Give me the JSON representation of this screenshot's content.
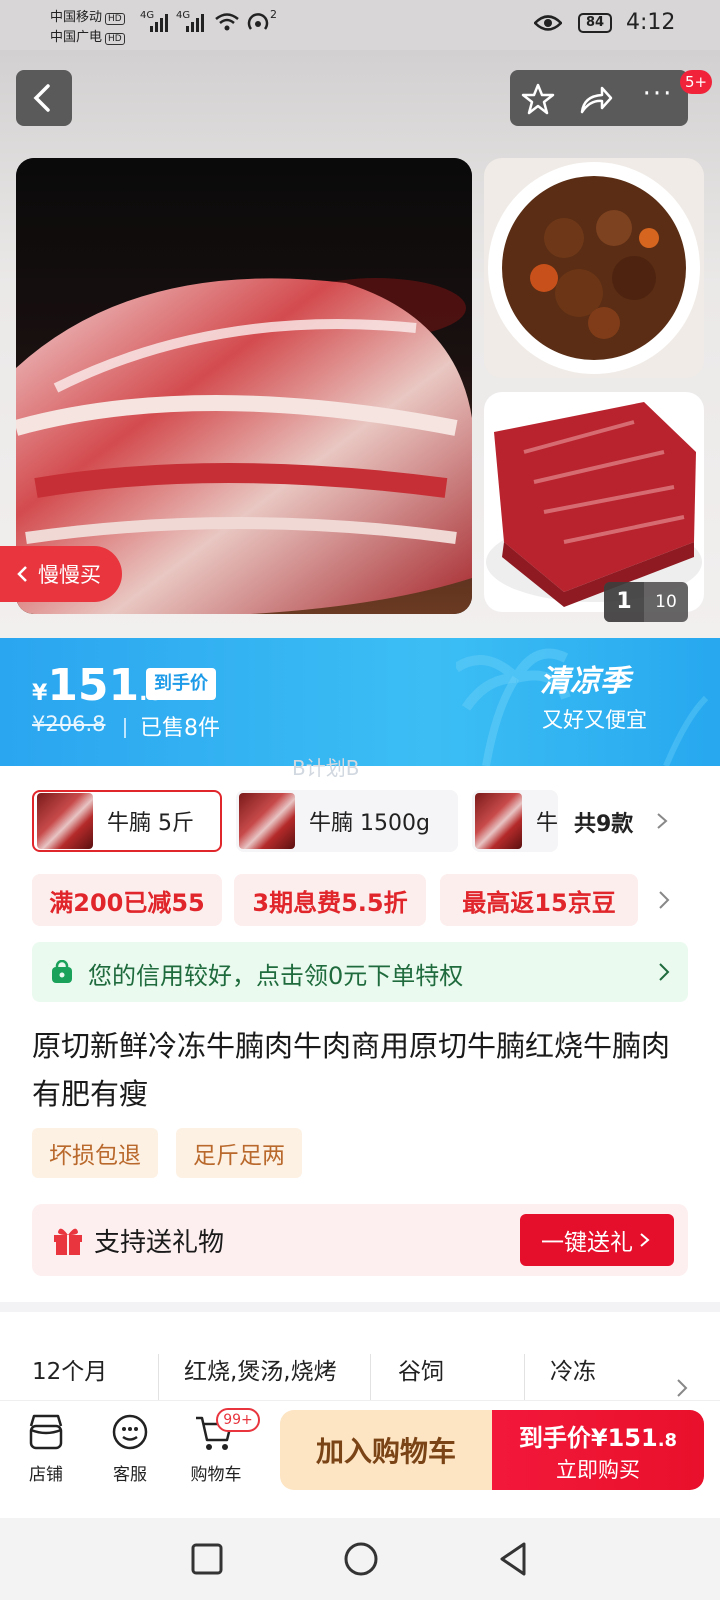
{
  "status_bar": {
    "carrier1": "中国移动",
    "carrier2": "中国广电",
    "hd": "HD",
    "net1": "4G",
    "net2": "4G",
    "hotspot_count": "2",
    "battery": "84",
    "time": "4:12"
  },
  "header": {
    "badge": "5+"
  },
  "gallery": {
    "slow_buy_label": "慢慢买",
    "page_current": "1",
    "page_total": "10"
  },
  "price": {
    "currency": "¥",
    "amount_int": "151",
    "amount_dec": ".8",
    "badge": "到手价",
    "original": "¥206.8",
    "sold": "已售8件",
    "promo_title": "清凉季",
    "promo_sub": "又好又便宜",
    "watermark": "B计划B"
  },
  "skus": {
    "items": [
      {
        "label": "牛腩 5斤"
      },
      {
        "label": "牛腩 1500g"
      },
      {
        "label": "牛"
      }
    ],
    "count": "共9款"
  },
  "coupons": [
    "满200已减55",
    "3期息费5.5折",
    "最高返15京豆"
  ],
  "credit": {
    "text": "您的信用较好，点击领0元下单特权"
  },
  "product": {
    "title": "原切新鲜冷冻牛腩肉牛肉商用原切牛腩红烧牛腩肉有肥有瘦",
    "tags": [
      "坏损包退",
      "足斤足两"
    ]
  },
  "gift": {
    "text": "支持送礼物",
    "button": "一键送礼"
  },
  "attributes": [
    "12个月",
    "红烧,煲汤,烧烤",
    "谷饲",
    "冷冻"
  ],
  "bottom_bar": {
    "store": "店铺",
    "service": "客服",
    "cart": "购物车",
    "cart_badge": "99+",
    "add_cart": "加入购物车",
    "buy_price_label": "到手价¥151",
    "buy_price_dec": ".8",
    "buy_now": "立即购买"
  },
  "colors": {
    "accent_red": "#e0262b",
    "price_blue": "#2aa5f0",
    "credit_green": "#1aa15a"
  }
}
